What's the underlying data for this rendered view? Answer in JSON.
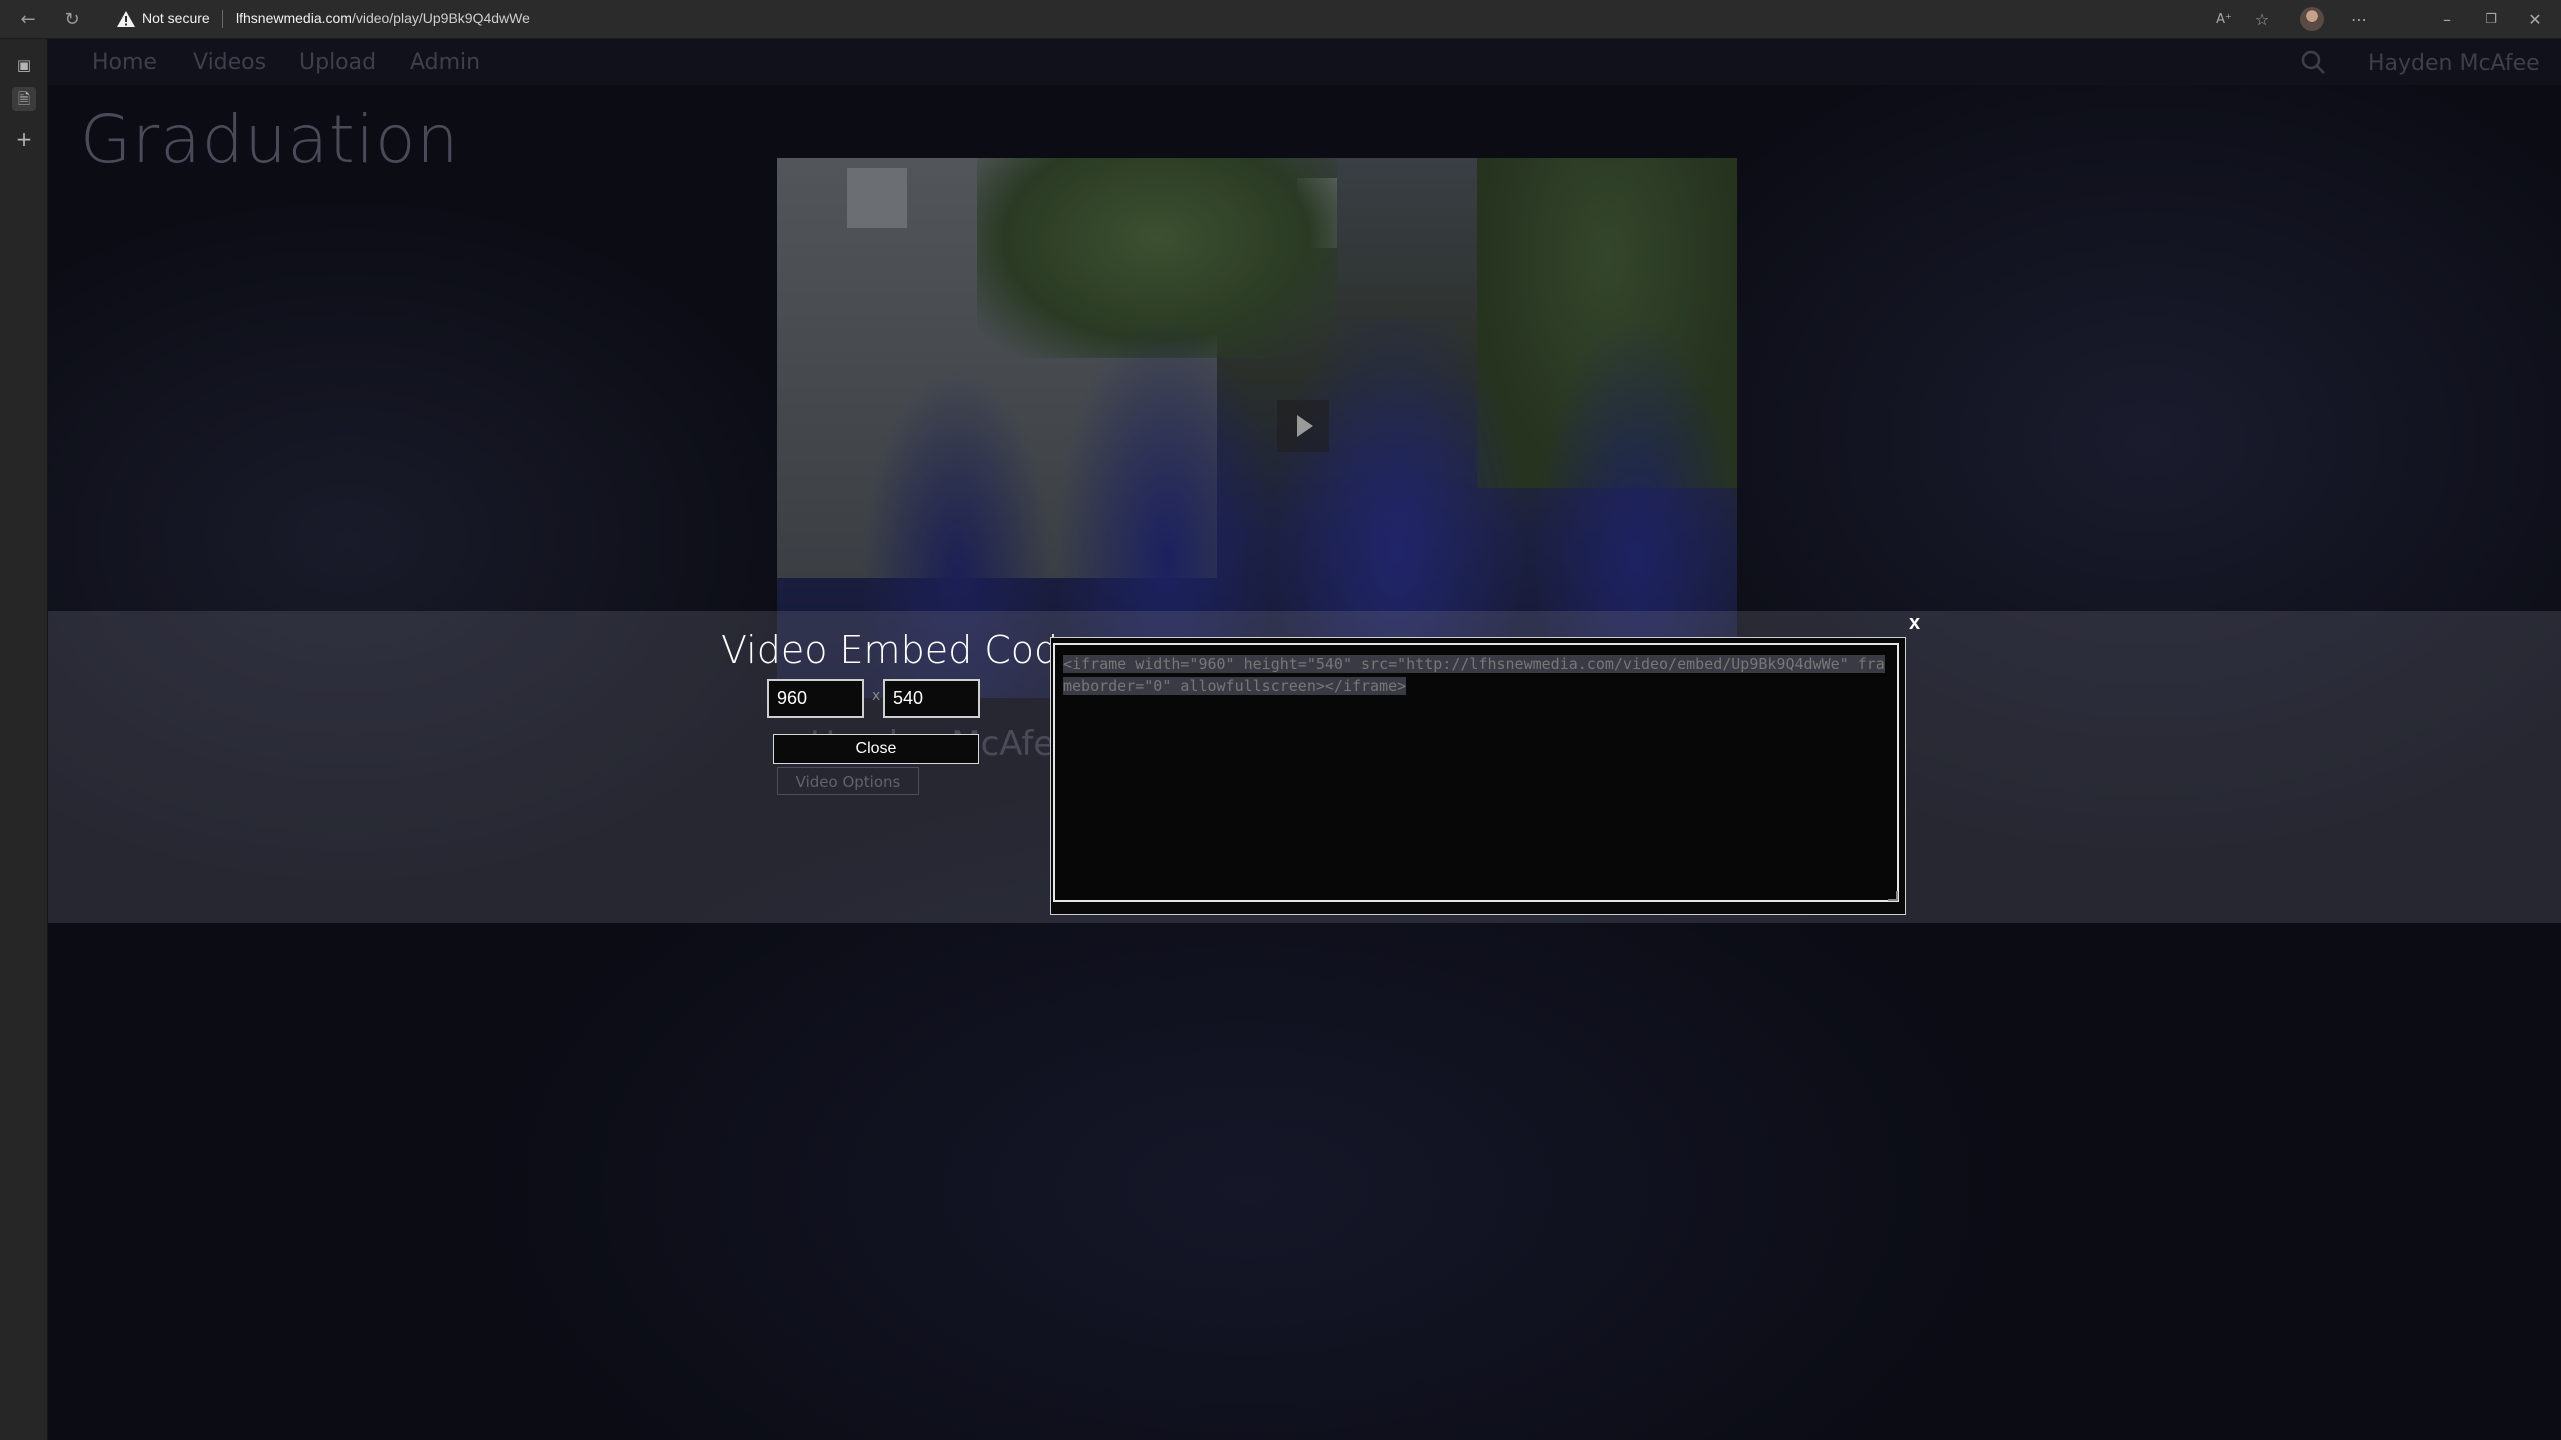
{
  "browser": {
    "security_label": "Not secure",
    "url_host": "lfhsnewmedia.com",
    "url_path": "/video/play/Up9Bk9Q4dwWe"
  },
  "site_nav": {
    "items": [
      {
        "label": "Home"
      },
      {
        "label": "Videos"
      },
      {
        "label": "Upload"
      },
      {
        "label": "Admin"
      }
    ],
    "user_name": "Hayden McAfee"
  },
  "page": {
    "title": "Graduation",
    "byline_prefix": "by",
    "author": "Hayden McAfee",
    "video_options_label": "Video Options"
  },
  "embed_modal": {
    "title": "Video Embed Code",
    "width_value": "960",
    "height_value": "540",
    "separator": "x",
    "close_label": "Close",
    "close_x": "x",
    "code": "<iframe width=\"960\" height=\"540\" src=\"http://lfhsnewmedia.com/video/embed/Up9Bk9Q4dwWe\" frameborder=\"0\" allowfullscreen></iframe>"
  },
  "colors": {
    "overlay_band": "#7a7b88",
    "modal_text": "#ffffff",
    "page_background": "#0b0c14"
  },
  "icons": {
    "back": "arrow-left-icon",
    "refresh": "refresh-icon",
    "warning": "warning-triangle-icon",
    "read_aloud": "read-aloud-icon",
    "favorites": "favorites-icon",
    "more": "more-horizontal-icon",
    "search": "search-icon",
    "play": "play-icon"
  }
}
